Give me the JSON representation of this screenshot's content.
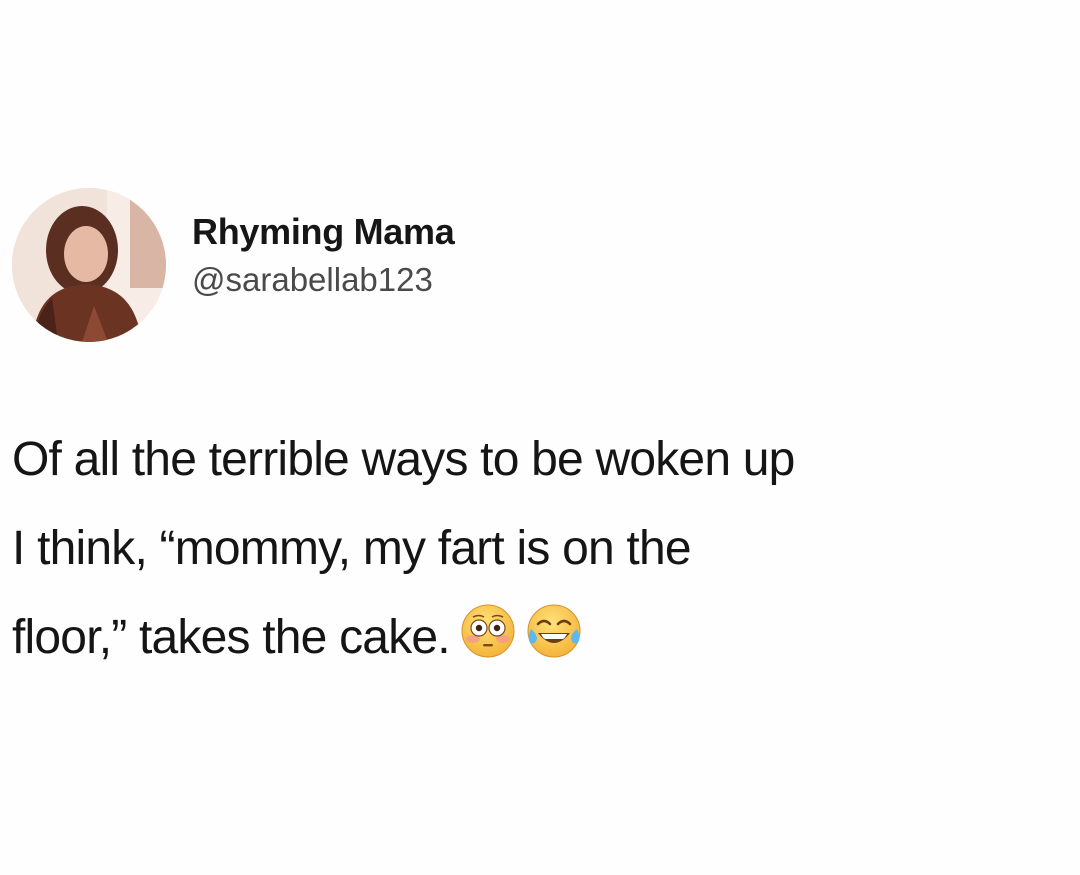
{
  "tweet": {
    "author": {
      "display_name": "Rhyming Mama",
      "handle": "@sarabellab123",
      "avatar_icon": "profile-photo"
    },
    "text_lines": [
      "Of all the terrible ways to be woken up",
      "I think, “mommy, my fart is on the",
      "floor,” takes the cake."
    ],
    "emojis": [
      "flushed-face-emoji",
      "tears-of-joy-emoji"
    ]
  }
}
